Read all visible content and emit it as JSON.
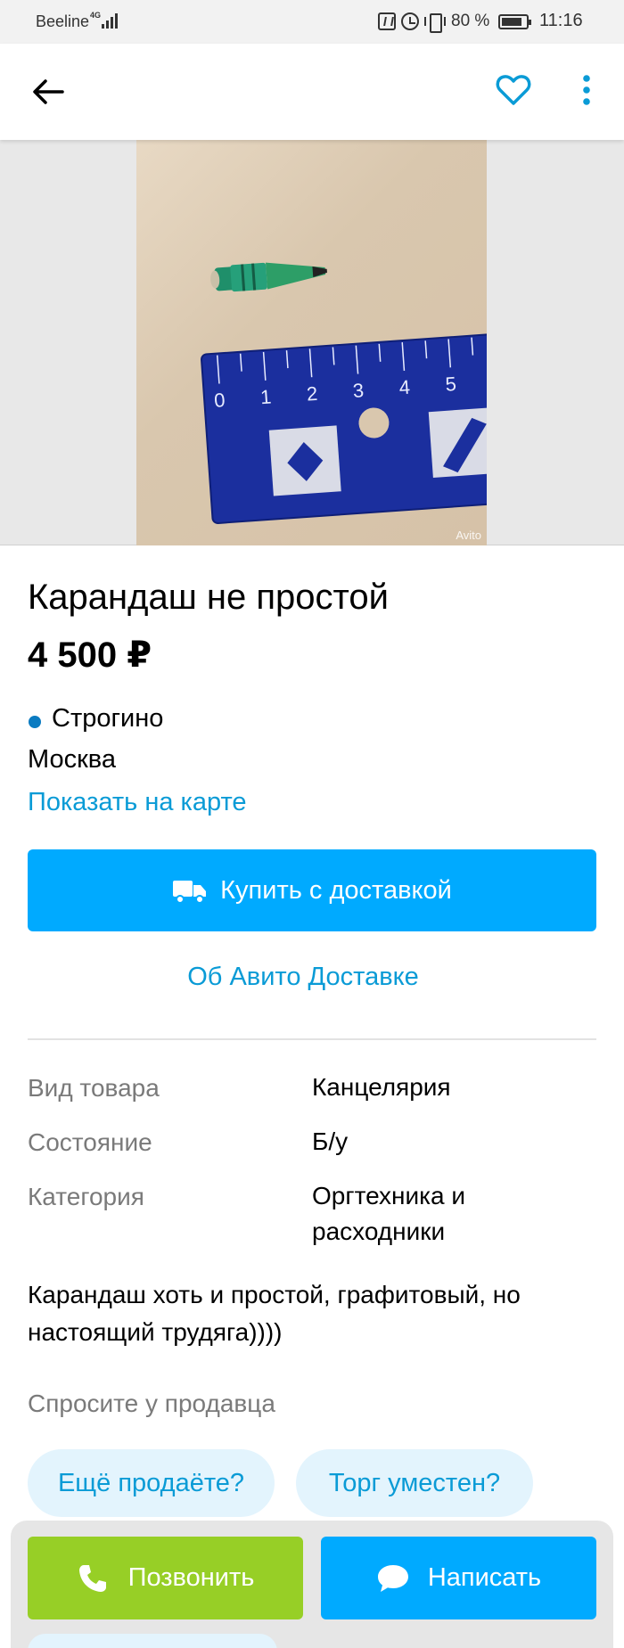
{
  "status_bar": {
    "carrier": "Beeline",
    "network": "4G",
    "battery": "80 %",
    "time": "11:16"
  },
  "app_bar": {
    "back_icon": "arrow-left-icon",
    "favorite_icon": "heart-outline-icon",
    "more_icon": "more-vertical-icon"
  },
  "photo": {
    "subject": "pencil-and-ruler-photo",
    "watermark": "Avito",
    "ruler_ticks": [
      "0",
      "1",
      "2",
      "3",
      "4",
      "5"
    ]
  },
  "listing": {
    "title": "Карандаш не простой",
    "price": "4 500 ₽",
    "metro": "Строгино",
    "metro_color": "#0a7bc1",
    "city": "Москва",
    "map_link": "Показать на карте"
  },
  "delivery": {
    "buy_button": "Купить с доставкой",
    "about_link": "Об Авито Доставке"
  },
  "params": [
    {
      "label": "Вид товара",
      "value": "Канцелярия"
    },
    {
      "label": "Состояние",
      "value": "Б/у"
    },
    {
      "label": "Категория",
      "value": "Оргтехника и расходники"
    }
  ],
  "description": "Карандаш хоть и простой, графитовый, но настоящий трудяга))))",
  "ask_seller": {
    "title": "Спросите у продавца",
    "chips": [
      "Ещё продаёте?",
      "Торг уместен?"
    ]
  },
  "actions": {
    "call": "Позвонить",
    "message": "Написать"
  },
  "colors": {
    "accent_blue": "#00aaff",
    "link_blue": "#0a9bd6",
    "call_green": "#97cf26"
  }
}
